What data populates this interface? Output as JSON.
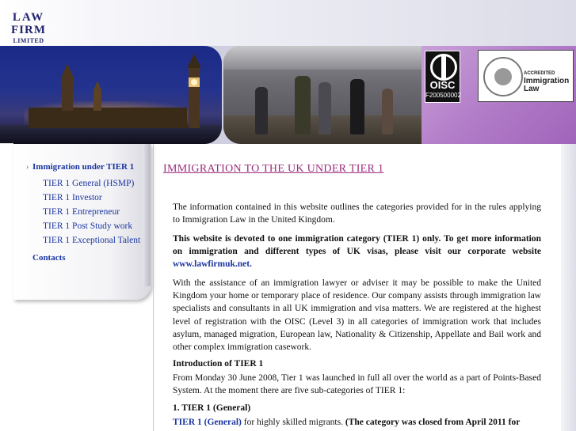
{
  "logo": {
    "line1": "LAW",
    "line2": "FIRM",
    "line3": "LIMITED"
  },
  "badges": {
    "oisc_name": "OISC",
    "oisc_number": "F200500002",
    "accred_small": "ACCREDITED",
    "accred_big": "Immigration Law",
    "accred_ring": "SOLICITORS REGULATION AUTHORITY"
  },
  "sidebar": {
    "arrow": "›",
    "main": "Immigration under TIER 1",
    "items": [
      "TIER 1 General (HSMP)",
      "TIER 1 Investor",
      "TIER 1 Entrepreneur",
      "TIER 1 Post Study work",
      "TIER 1 Exceptional Talent"
    ],
    "contacts": "Contacts"
  },
  "main": {
    "title": "IMMIGRATION TO THE UK UNDER TIER 1",
    "p1": "The information contained in this website outlines the categories provided for in the rules applying to Immigration Law in the United Kingdom.",
    "p2_text": "This website is devoted to one immigration category (TIER 1) only. To get more information on immigration and different types of UK visas, please visit our corporate website",
    "p2_link": "www.lawfirmuk.net.",
    "p3": "With the assistance of an immigration lawyer or adviser it may be possible to make the United Kingdom your home or temporary place of residence. Our company assists through immigration law specialists and consultants in all UK immigration and visa matters. We are registered at the highest level of registration with the OISC (Level 3) in all categories of immigration work that includes asylum, managed migration, European law, Nationality & Citizenship, Appellate and Bail work and other complex immigration casework.",
    "intro_heading": "Introduction of TIER 1",
    "intro_text": "From Monday 30 June 2008, Tier 1 was launched in full all over the world as a part of Points-Based System. At the moment there are five sub-categories of TIER 1:",
    "sec1_heading": "1. TIER 1 (General)",
    "sec1_link": "TIER 1 (General)",
    "sec1_text": " for highly skilled migrants. ",
    "sec1_bold": "(The category was closed from April 2011 for"
  }
}
